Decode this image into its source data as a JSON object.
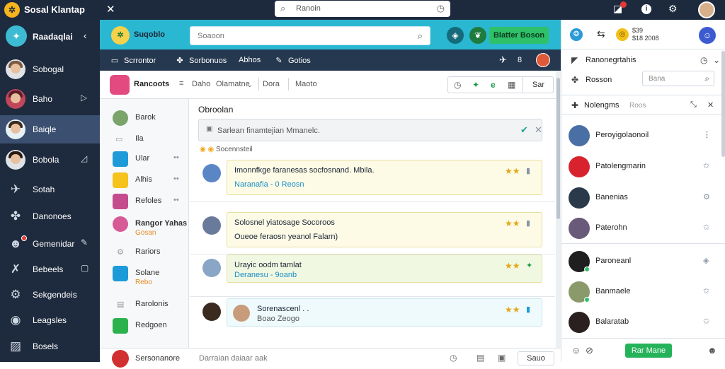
{
  "window": {
    "title": "Sosal Klantap",
    "search_placeholder": "Ranoin"
  },
  "sidebar": {
    "header_label": "Raadaqlai",
    "items": [
      {
        "label": "Sobogal",
        "icon": "avatar"
      },
      {
        "label": "Baho",
        "icon": "avatar"
      },
      {
        "label": "Baiqle",
        "icon": "avatar"
      },
      {
        "label": "Bobola",
        "icon": "avatar"
      },
      {
        "label": "Sotah",
        "icon": "twitter-icon"
      },
      {
        "label": "Danonoes",
        "icon": "friends-icon"
      },
      {
        "label": "Gemenidar",
        "icon": "ghost-icon"
      },
      {
        "label": "Bebeels",
        "icon": "wrench-icon"
      },
      {
        "label": "Sekgendeis",
        "icon": "gear-icon"
      },
      {
        "label": "Leagsles",
        "icon": "eye-icon"
      },
      {
        "label": "Bosels",
        "icon": "image-icon"
      }
    ]
  },
  "header": {
    "app_name": "Suqoblo",
    "search_placeholder": "Soaoon",
    "cta_label": "Blatter Boson"
  },
  "subnav": {
    "items": [
      "Scrrontor",
      "Sorbonuos",
      "Abhos",
      "Gotios"
    ],
    "right_label": "8"
  },
  "conversation": {
    "name": "Rancoots",
    "tabs": [
      "Daho",
      "Olamatne",
      "Dora",
      "Maoto"
    ],
    "tools_button": "Sar"
  },
  "contacts": [
    {
      "label": "Barok"
    },
    {
      "label": "Ila"
    },
    {
      "label": "Ular"
    },
    {
      "label": "Alhis"
    },
    {
      "label": "Refoles"
    },
    {
      "label": "Rangor Yahas",
      "sub": "Gosan"
    },
    {
      "label": "Rariors"
    },
    {
      "label": "Solane",
      "sub": "Rebo"
    },
    {
      "label": "Rarolonis"
    },
    {
      "label": "Redgoen"
    },
    {
      "label": "Sersonanore"
    }
  ],
  "chat": {
    "title": "Obroolan",
    "filter_text": "Sarlean finamtejian Mmanelc.",
    "meta_text": "Socennsteil",
    "messages": [
      {
        "line1": "Imonnfkge faranesas socfosnand. Mbila.",
        "line2": "Naranafia - 0 Reosn"
      },
      {
        "line1": "Solosnel yiatosage Socoroos",
        "line2": "Oueoe feraosn yeanol Falarn)"
      },
      {
        "line1": "Urayic oodm tamlat",
        "line2": "Deranesu - 9oanb"
      },
      {
        "line1": "Sorenascenl . .",
        "line2": "Boao Zeogo"
      }
    ]
  },
  "composer": {
    "label": "Sersonanore",
    "placeholder": "Darraian daiaar aak",
    "send_label": "Sauo"
  },
  "right_panel": {
    "top_number_1": "$39",
    "top_number_2": "$18 2008",
    "row1_label": "Ranonegrtahis",
    "row2_label": "Rosson",
    "search_placeholder": "Bana",
    "section_label": "Nolengms",
    "section_count": "Roos",
    "friends": [
      {
        "label": "Peroyigolaonoil"
      },
      {
        "label": "Patolengmarin"
      },
      {
        "label": "Banenias"
      },
      {
        "label": "Paterohn"
      },
      {
        "label": "Paroneanl"
      },
      {
        "label": "Banmaele"
      },
      {
        "label": "Balaratab"
      }
    ],
    "footer_button": "Rar Mane"
  },
  "colors": {
    "header_accent": "#2ab7d1",
    "cta": "#2ec16a",
    "sidebar": "#1e2a3d",
    "star": "#e5a716"
  }
}
